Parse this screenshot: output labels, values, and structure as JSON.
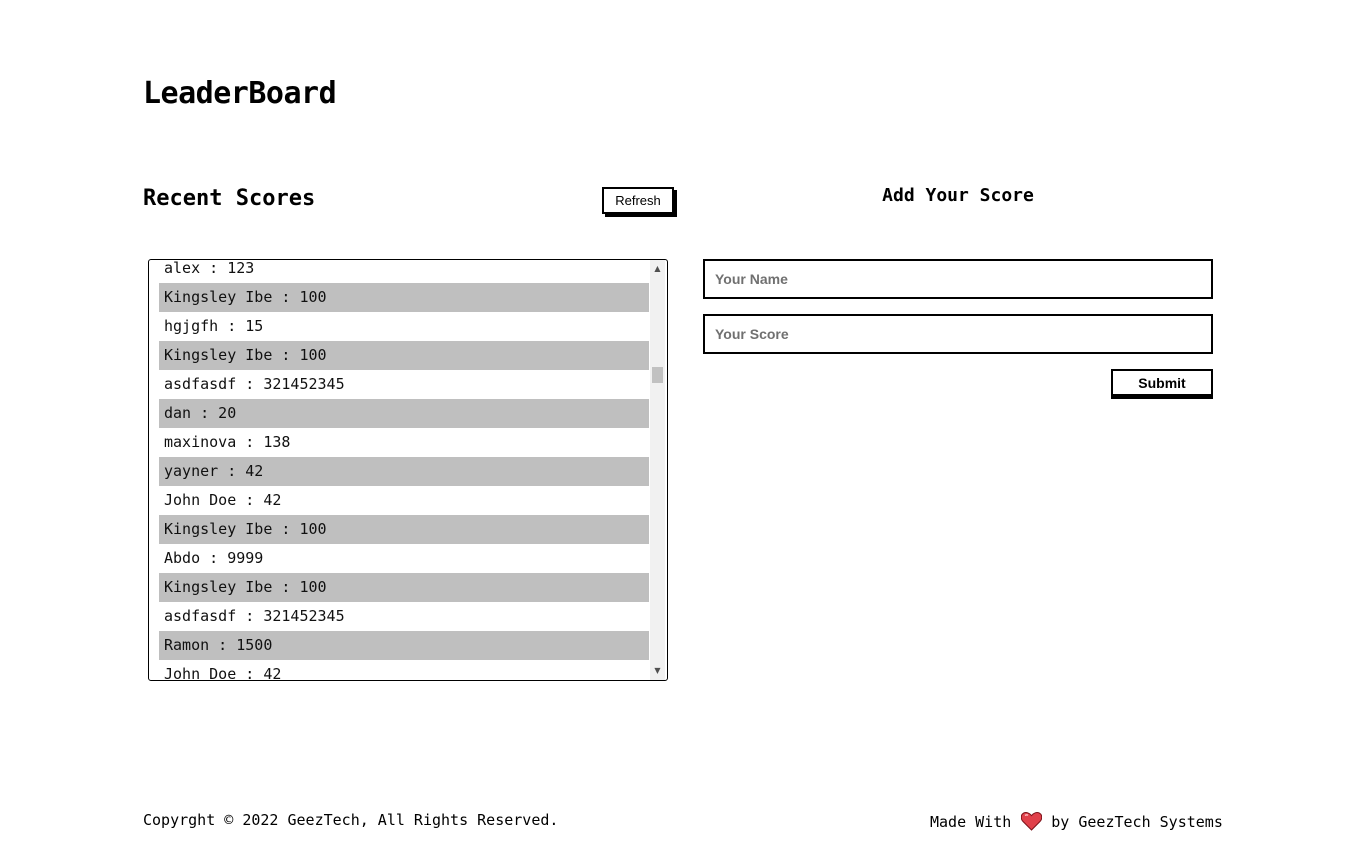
{
  "header": {
    "title": "LeaderBoard"
  },
  "scores_section": {
    "title": "Recent Scores",
    "refresh_label": "Refresh",
    "scores": [
      "alex : 123",
      "Kingsley Ibe : 100",
      "hgjgfh : 15",
      "Kingsley Ibe : 100",
      "asdfasdf : 321452345",
      "dan : 20",
      "maxinova : 138",
      "yayner : 42",
      "John Doe : 42",
      "Kingsley Ibe : 100",
      "Abdo : 9999",
      "Kingsley Ibe : 100",
      "asdfasdf : 321452345",
      "Ramon : 1500",
      "John Doe : 42"
    ]
  },
  "form": {
    "title": "Add Your Score",
    "name_placeholder": "Your Name",
    "score_placeholder": "Your Score",
    "submit_label": "Submit"
  },
  "footer": {
    "copyright": "Copyrght © 2022 GeezTech, All Rights Reserved.",
    "made_with": "Made With",
    "by_text": "by GeezTech Systems"
  },
  "colors": {
    "row_alt": "#bfbfbf",
    "heart": "#e0404a"
  },
  "icons": {
    "heart": "heart-icon"
  }
}
